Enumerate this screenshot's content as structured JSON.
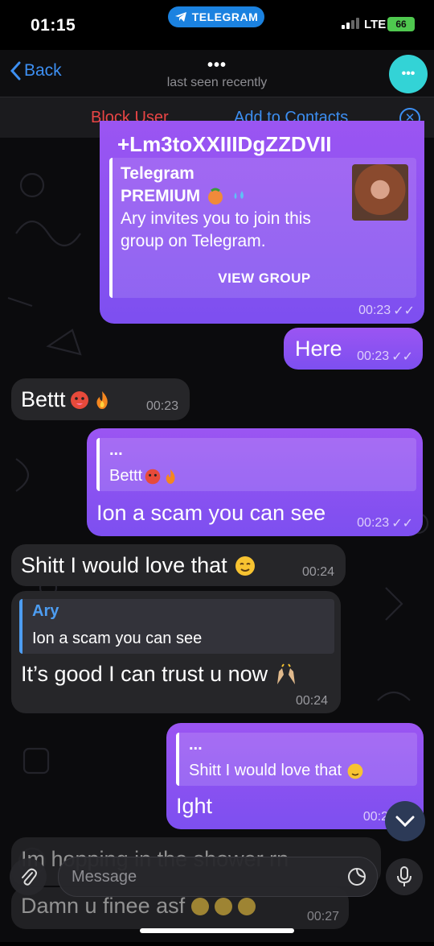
{
  "status": {
    "time": "01:15",
    "app_pill": "TELEGRAM",
    "network": "LTE",
    "battery": "66"
  },
  "header": {
    "back_label": "Back",
    "title": "•••",
    "subtitle": "last seen recently",
    "avatar_text": "•••"
  },
  "actions": {
    "block": "Block User",
    "add_contacts": "Add to Contacts"
  },
  "messages": {
    "m1": {
      "partial_link": "+Lm3toXXIIIDgZZDVII",
      "preview_site": "Telegram",
      "preview_title": "PREMIUM",
      "preview_desc_1": "Ary invites you to join this",
      "preview_desc_2": "group on Telegram.",
      "button": "VIEW GROUP",
      "time": "00:23"
    },
    "m2": {
      "text": "Here",
      "time": "00:23"
    },
    "m3": {
      "text": "Bettt",
      "time": "00:23"
    },
    "m4": {
      "quote_name": "...",
      "quote_text": "Bettt",
      "text": "Ion a scam you can see",
      "time": "00:23"
    },
    "m5": {
      "text": "Shitt I would love that",
      "time": "00:24"
    },
    "m6": {
      "quote_name": "Ary",
      "quote_text": "Ion a scam you can see",
      "text": "It’s good I can trust u now",
      "time": "00:24"
    },
    "m7": {
      "quote_name": "...",
      "quote_text": "Shitt I would love that",
      "text": "Ight",
      "time": "00:2"
    },
    "m8": {
      "text": "Im hopping in the shower rn"
    },
    "m9": {
      "text": "Damn u finee asf",
      "time": "00:27"
    }
  },
  "composer": {
    "placeholder": "Message"
  },
  "colors": {
    "accent": "#3d8ff2",
    "outgoing": "#8b52f1",
    "incoming": "#262629",
    "danger": "#e94545"
  }
}
